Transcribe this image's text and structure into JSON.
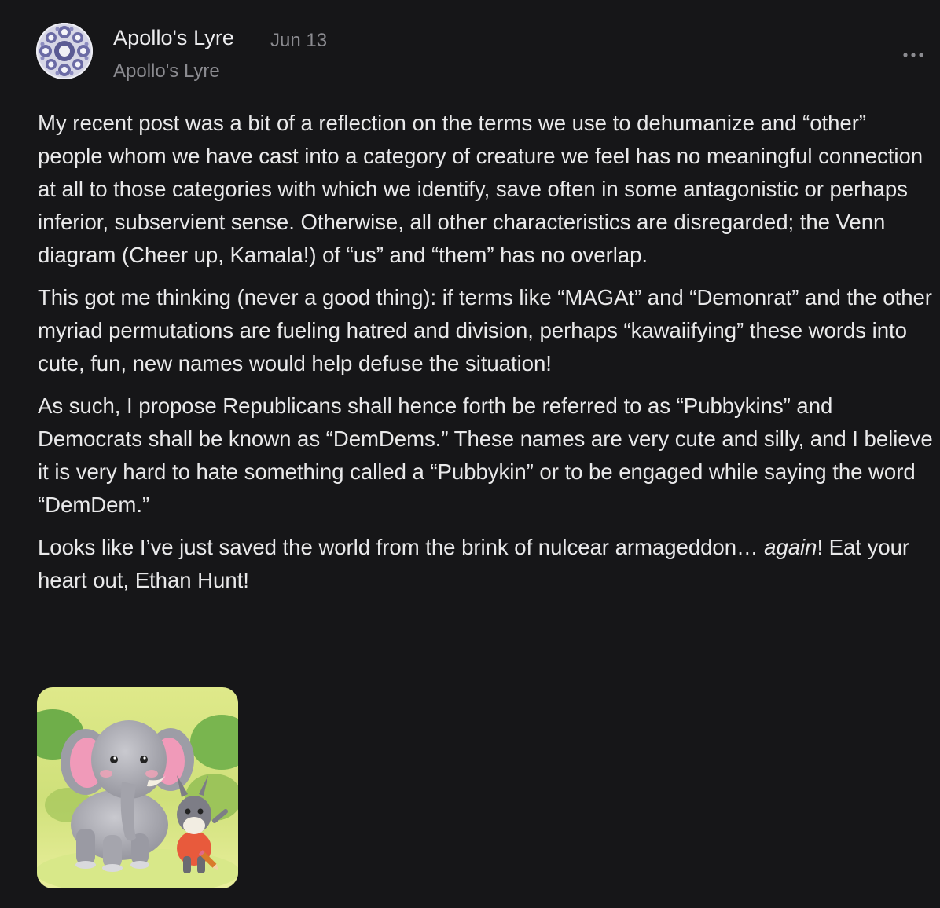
{
  "note": {
    "author": {
      "name": "Apollo's Lyre",
      "publication": "Apollo's Lyre",
      "avatar_icon": "fractal-pattern-avatar"
    },
    "date": "Jun 13",
    "more_icon": "more-horizontal-icon",
    "paragraphs": [
      "My recent post was a bit of a reflection on the terms we use to dehumanize and “other” people whom we have cast into a category of creature we feel has no meaningful connection at all to those categories with which we identify, save often in some antagonistic or perhaps inferior, subservient sense. Otherwise, all other characteristics are disregarded; the Venn diagram (Cheer up, Kamala!) of “us” and “them” has no overlap.",
      "This got me thinking (never a good thing): if terms like “MAGAt” and “Demonrat” and the other myriad permutations are fueling hatred and division, perhaps “kawaiifying” these words into cute, fun, new names would help defuse the situation!",
      "As such, I propose Republicans shall hence forth be referred to as “Pubbykins” and Democrats shall be known as “DemDems.” These names are very cute and silly, and I believe it is very hard to hate something called a “Pubbykin” or to be engaged while saying the word “DemDem.”"
    ],
    "last_paragraph": {
      "before": "Looks like I’ve just saved the world from the brink of nulcear armageddon… ",
      "emphasis": "again",
      "after": "! Eat your heart out, Ethan Hunt!"
    },
    "image": {
      "description_icon": "cartoon-elephant-and-donkey-image",
      "badge_icon": "pencil-icon"
    },
    "colors": {
      "background": "#161618",
      "text": "#e9e9ea",
      "muted": "#8b8b90"
    }
  }
}
